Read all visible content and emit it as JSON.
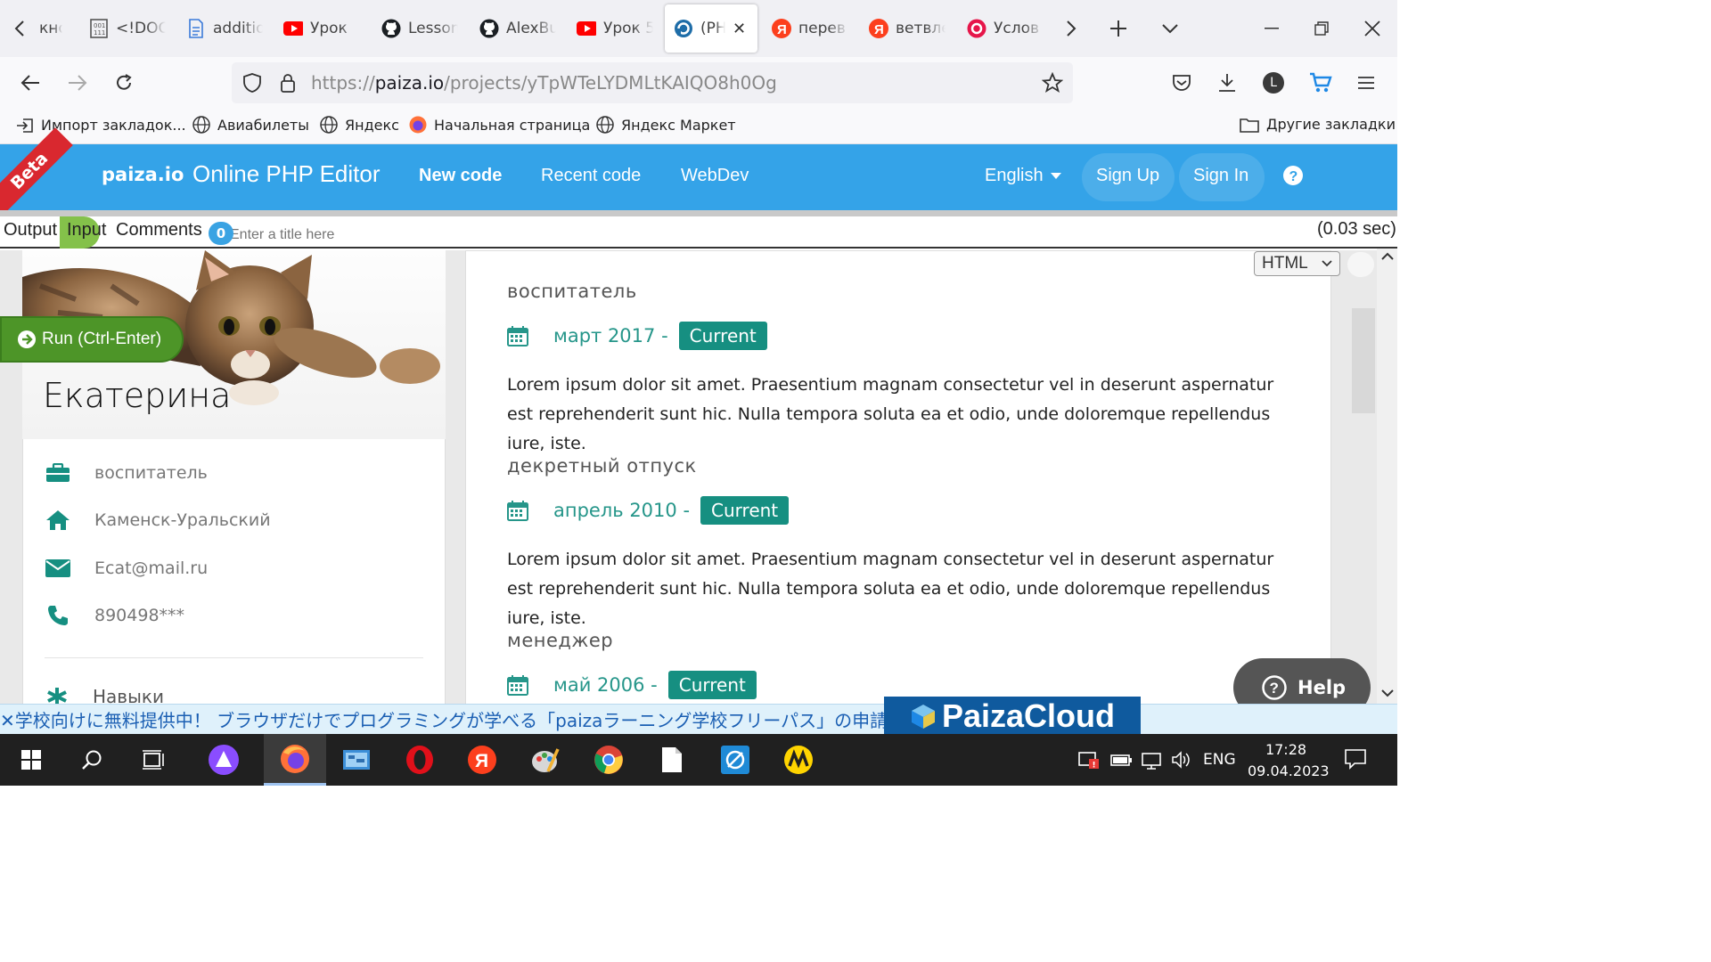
{
  "browser": {
    "tabs": [
      {
        "label": "кнор",
        "icon": "page-icon"
      },
      {
        "label": "<!DOCTYPE",
        "icon": "code-file-icon"
      },
      {
        "label": "additional",
        "icon": "document-icon"
      },
      {
        "label": "Урок",
        "icon": "youtube-icon"
      },
      {
        "label": "Lesson",
        "icon": "github-icon"
      },
      {
        "label": "AlexBu",
        "icon": "github-icon"
      },
      {
        "label": "Урок 5",
        "icon": "youtube-icon"
      },
      {
        "label": "(PH",
        "icon": "paiza-icon",
        "active": true
      },
      {
        "label": "перев",
        "icon": "yandex-icon"
      },
      {
        "label": "ветвле",
        "icon": "yandex-icon"
      },
      {
        "label": "Услов",
        "icon": "yandex-red-icon"
      }
    ],
    "url_scheme": "https://",
    "url_host": "paiza.io",
    "url_path": "/projects/yTpWTeLYDMLtKAIQO8h0Og",
    "bookmarks": [
      {
        "label": "Импорт закладок...",
        "icon": "import-icon"
      },
      {
        "label": "Авиабилеты",
        "icon": "globe-icon"
      },
      {
        "label": "Яндекс",
        "icon": "globe-icon"
      },
      {
        "label": "Начальная страница",
        "icon": "firefox-icon"
      },
      {
        "label": "Яндекс Маркет",
        "icon": "globe-icon"
      }
    ],
    "other_bookmarks": "Другие закладки",
    "account_initial": "L"
  },
  "paiza": {
    "beta": "Beta",
    "logo": "paiza.io",
    "title": "Online PHP Editor",
    "nav": {
      "new_code": "New code",
      "recent_code": "Recent code",
      "webdev": "WebDev",
      "language": "English",
      "sign_up": "Sign Up",
      "sign_in": "Sign In"
    },
    "toolbar": {
      "output": "Output",
      "input": "Input",
      "comments": "Comments",
      "comment_count": "0",
      "title_placeholder": "Enter a title here",
      "timing": "(0.03 sec)"
    },
    "run_button": "Run (Ctrl-Enter)",
    "format_select": "HTML",
    "help": "Help"
  },
  "resume": {
    "name": "Екатерина",
    "info": [
      {
        "icon": "briefcase-icon",
        "text": "воспитатель"
      },
      {
        "icon": "home-icon",
        "text": "Каменск-Уральский"
      },
      {
        "icon": "envelope-icon",
        "text": "Ecat@mail.ru"
      },
      {
        "icon": "phone-icon",
        "text": "890498***"
      }
    ],
    "skills_heading": "Навыки",
    "jobs": [
      {
        "title": "воспитатель",
        "date": "март 2017 -",
        "badge": "Current",
        "desc": "Lorem ipsum dolor sit amet. Praesentium magnam consectetur vel in deserunt aspernatur est reprehenderit sunt hic. Nulla tempora soluta ea et odio, unde doloremque repellendus iure, iste."
      },
      {
        "title": "декретный отпуск",
        "date": "апрель 2010 -",
        "badge": "Current",
        "desc": "Lorem ipsum dolor sit amet. Praesentium magnam consectetur vel in deserunt aspernatur est reprehenderit sunt hic. Nulla tempora soluta ea et odio, unde doloremque repellendus iure, iste."
      },
      {
        "title": "менеджер",
        "date": "май 2006 -",
        "badge": "Current",
        "desc": ""
      }
    ]
  },
  "ad": {
    "close": "✕",
    "text": "学校向けに無料提供中！ ブラウザだけでプログラミングが学べる「paizaラーニング学校フリーパス」の申請",
    "brand": "PaizaCloud"
  },
  "taskbar": {
    "apps": [
      "start-icon",
      "search-icon",
      "task-view-icon",
      "alice-icon",
      "firefox-icon",
      "control-panel-icon",
      "opera-icon",
      "yandex-browser-icon",
      "paint-icon",
      "chrome-icon",
      "file-icon",
      "snipping-tool-icon",
      "yandex-market-icon"
    ],
    "language": "ENG",
    "time": "17:28",
    "date": "09.04.2023"
  },
  "colors": {
    "paiza_blue": "#34a3e8",
    "run_green": "#4d9528",
    "teal": "#168f81",
    "beta_red": "#d9282f"
  }
}
